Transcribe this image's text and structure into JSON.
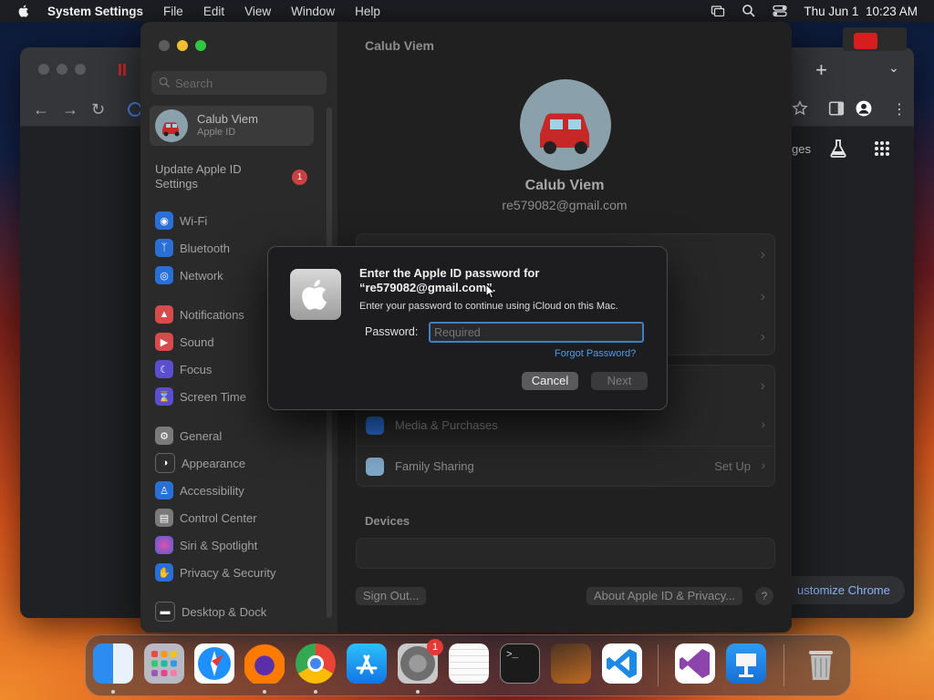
{
  "menubar": {
    "app": "System Settings",
    "items": [
      "File",
      "Edit",
      "View",
      "Window",
      "Help"
    ],
    "datetime": "Thu Jun 1  10:23 AM"
  },
  "chrome": {
    "partial_label": "ges",
    "customize_label": "ustomize Chrome"
  },
  "settings": {
    "window_title": "Calub Viem",
    "search_placeholder": "Search",
    "account": {
      "name": "Calub Viem",
      "sub": "Apple ID"
    },
    "update": {
      "label": "Update Apple ID Settings",
      "badge": "1"
    },
    "sidebar_items": [
      {
        "label": "Wi-Fi",
        "icon": "wifi-icon",
        "color": "#2a6fd6"
      },
      {
        "label": "Bluetooth",
        "icon": "bluetooth-icon",
        "color": "#2a6fd6"
      },
      {
        "label": "Network",
        "icon": "globe-icon",
        "color": "#2a6fd6"
      },
      {
        "label": "Notifications",
        "icon": "bell-icon",
        "color": "#d84b4b"
      },
      {
        "label": "Sound",
        "icon": "speaker-icon",
        "color": "#d84b4b"
      },
      {
        "label": "Focus",
        "icon": "moon-icon",
        "color": "#5b4fd0"
      },
      {
        "label": "Screen Time",
        "icon": "hourglass-icon",
        "color": "#5b4fd0"
      },
      {
        "label": "General",
        "icon": "gear-icon",
        "color": "#7a7a7a"
      },
      {
        "label": "Appearance",
        "icon": "appearance-icon",
        "color": "#2d2d2d"
      },
      {
        "label": "Accessibility",
        "icon": "accessibility-icon",
        "color": "#2a6fd6"
      },
      {
        "label": "Control Center",
        "icon": "control-center-icon",
        "color": "#7a7a7a"
      },
      {
        "label": "Siri & Spotlight",
        "icon": "siri-icon",
        "color": "#9b4fd0"
      },
      {
        "label": "Privacy & Security",
        "icon": "hand-icon",
        "color": "#2a6fd6"
      },
      {
        "label": "Desktop & Dock",
        "icon": "dock-icon",
        "color": "#2d2d2d"
      }
    ],
    "profile": {
      "name": "Calub Viem",
      "email": "re579082@gmail.com"
    },
    "rows": [
      {
        "label": "Media & Purchases",
        "value": ""
      },
      {
        "label": "Family Sharing",
        "value": "Set Up"
      }
    ],
    "devices_heading": "Devices",
    "sign_out": "Sign Out...",
    "about": "About Apple ID & Privacy...",
    "help": "?"
  },
  "dialog": {
    "title": "Enter the Apple ID password for “re579082@gmail.com”.",
    "description": "Enter your password to continue using iCloud on this Mac.",
    "password_label": "Password:",
    "password_placeholder": "Required",
    "forgot": "Forgot Password?",
    "cancel": "Cancel",
    "next": "Next"
  },
  "dock": {
    "apps": [
      "Finder",
      "Launchpad",
      "Safari",
      "Firefox",
      "Chrome",
      "App Store",
      "System Settings",
      "TextEdit",
      "Terminal",
      "GarageBand",
      "Visual Studio Code",
      "Visual Studio",
      "Keynote",
      "Trash"
    ],
    "settings_badge": "1"
  }
}
